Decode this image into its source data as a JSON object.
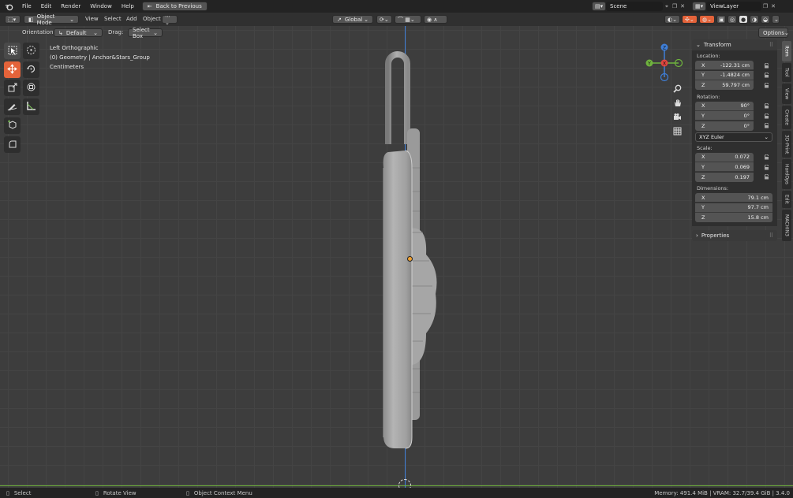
{
  "menubar": {
    "items": [
      "File",
      "Edit",
      "Render",
      "Window",
      "Help"
    ],
    "back_button": "Back to Previous",
    "scene": "Scene",
    "view_layer": "ViewLayer"
  },
  "header": {
    "mode": "Object Mode",
    "menus": [
      "View",
      "Select",
      "Add",
      "Object"
    ],
    "transform_orientation": "Global",
    "options": "Options",
    "orientation_label": "Orientation:",
    "orientation_value": "Default",
    "drag_label": "Drag:",
    "drag_value": "Select Box"
  },
  "viewport": {
    "view_name": "Left Orthographic",
    "object_info": "(0) Geometry | Anchor&Stars_Group",
    "units": "Centimeters"
  },
  "gizmo": {
    "z": "Z",
    "y": "Y",
    "x": "X"
  },
  "npanel": {
    "transform_title": "Transform",
    "location_label": "Location:",
    "location": [
      {
        "axis": "X",
        "value": "-122.31 cm"
      },
      {
        "axis": "Y",
        "value": "-1.4824 cm"
      },
      {
        "axis": "Z",
        "value": "59.797 cm"
      }
    ],
    "rotation_label": "Rotation:",
    "rotation": [
      {
        "axis": "X",
        "value": "90°"
      },
      {
        "axis": "Y",
        "value": "0°"
      },
      {
        "axis": "Z",
        "value": "0°"
      }
    ],
    "rotation_mode": "XYZ Euler",
    "scale_label": "Scale:",
    "scale": [
      {
        "axis": "X",
        "value": "0.072"
      },
      {
        "axis": "Y",
        "value": "0.069"
      },
      {
        "axis": "Z",
        "value": "0.197"
      }
    ],
    "dimensions_label": "Dimensions:",
    "dimensions": [
      {
        "axis": "X",
        "value": "79.1 cm"
      },
      {
        "axis": "Y",
        "value": "97.7 cm"
      },
      {
        "axis": "Z",
        "value": "15.8 cm"
      }
    ],
    "properties_title": "Properties"
  },
  "tabs": [
    "Item",
    "Tool",
    "View",
    "Create",
    "3D-Print",
    "HardOps",
    "Edit",
    "MACHIN3"
  ],
  "statusbar": {
    "select": "Select",
    "rotate_view": "Rotate View",
    "context_menu": "Object Context Menu",
    "stats": "Memory: 491.4 MiB | VRAM: 32.7/39.4 GiB | 3.4.0"
  },
  "colors": {
    "accent": "#e4633a",
    "x_axis": "#e0453f",
    "y_axis": "#6fb33e",
    "z_axis": "#3f7fd8",
    "origin": "#f0a030"
  }
}
